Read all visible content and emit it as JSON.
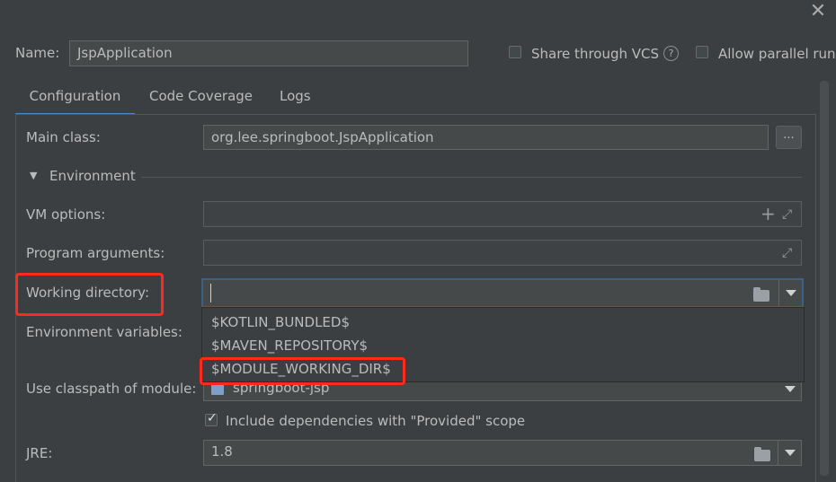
{
  "window": {
    "close_glyph": "✕"
  },
  "header": {
    "name_label": "Name:",
    "name_value": "JspApplication",
    "share_vcs_label": "Share through VCS",
    "help_glyph": "?",
    "allow_parallel_label": "Allow parallel run"
  },
  "tabs": [
    {
      "label": "Configuration",
      "active": true
    },
    {
      "label": "Code Coverage",
      "active": false
    },
    {
      "label": "Logs",
      "active": false
    }
  ],
  "form": {
    "main_class_label": "Main class:",
    "main_class_value": "org.lee.springboot.JspApplication",
    "browse_label": "...",
    "environment_section": "Environment",
    "vm_options_label": "VM options:",
    "vm_options_value": "",
    "program_args_label": "Program arguments:",
    "program_args_value": "",
    "working_dir_label": "Working directory:",
    "working_dir_value": "",
    "env_vars_label": "Environment variables:",
    "classpath_label": "Use classpath of module:",
    "classpath_value": "springboot-jsp",
    "include_deps_label": "Include dependencies with \"Provided\" scope",
    "include_deps_checked": true,
    "jre_label": "JRE:",
    "jre_value": "1.8"
  },
  "working_dir_popup": {
    "items": [
      "$KOTLIN_BUNDLED$",
      "$MAVEN_REPOSITORY$",
      "$MODULE_WORKING_DIR$"
    ]
  },
  "icons": {
    "plus": "+",
    "expand": "⤢",
    "section_toggle": "▼"
  },
  "colors": {
    "background": "#3c3f41",
    "field_bg": "#45494a",
    "accent_tab": "#4a88c7",
    "focus_border": "#3d6185",
    "highlight_red": "#ff2a1e"
  }
}
